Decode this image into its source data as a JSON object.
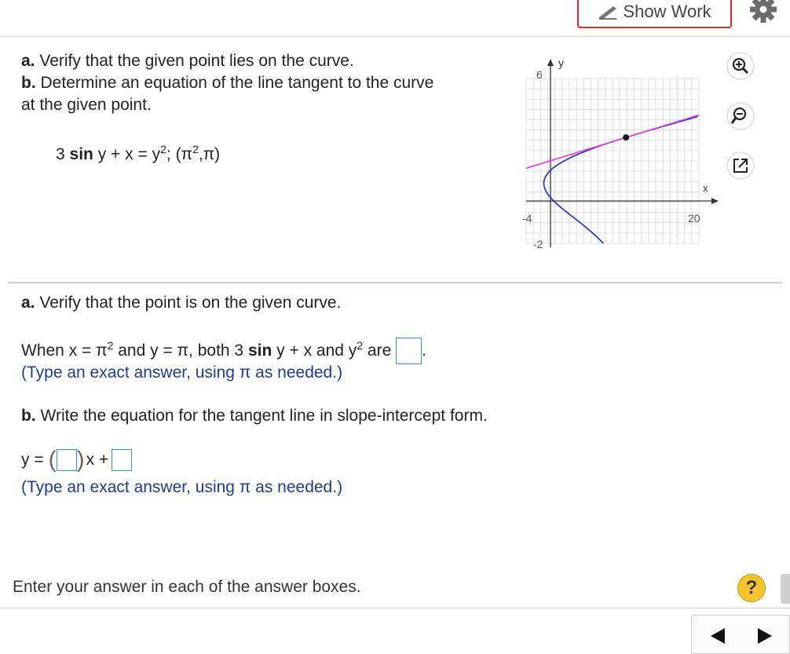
{
  "header": {
    "show_work_label": "Show Work"
  },
  "problem": {
    "part_a_label": "a.",
    "part_a_text": "Verify that the given point lies on the curve.",
    "part_b_label": "b.",
    "part_b_text": "Determine an equation of the line tangent to the curve",
    "part_b_text2": "at the given point.",
    "equation": {
      "coef": "3",
      "sin": "sin",
      "lhs_rest": "y + x = y",
      "exp": "2",
      "sep": ";",
      "point_open": "(π",
      "point_exp": "2",
      "point_close": ",π)"
    }
  },
  "graph": {
    "y_label": "y",
    "x_label": "x",
    "y_tick_top": "6",
    "y_tick_bottom": "-2",
    "x_tick_left": "-4",
    "x_tick_right": "20"
  },
  "chart_data": {
    "type": "line",
    "xlim": [
      -4,
      20
    ],
    "ylim": [
      -2,
      6
    ],
    "series": [
      {
        "kind": "curve",
        "equation": "x = y^2 - 3 sin y",
        "color": "#1a2cc8"
      },
      {
        "kind": "tangent_line",
        "color": "#e040e0"
      }
    ],
    "points": [
      {
        "x": 9.87,
        "y": 3.14
      }
    ]
  },
  "part_a": {
    "heading_label": "a.",
    "heading_text": "Verify that the point is on the given curve.",
    "when": "When x = π",
    "exp1": "2",
    "and1": " and y = π, both 3 ",
    "sin": "sin",
    "mid": " y + x and y",
    "exp2": "2",
    "are": " are",
    "period": ".",
    "hint": "(Type an exact answer, using π as needed.)"
  },
  "part_b": {
    "heading_label": "b.",
    "heading_text": "Write the equation for the tangent line in slope-intercept form.",
    "y_eq": "y =",
    "x_plus": "x +",
    "hint": "(Type an exact answer, using π as needed.)"
  },
  "footer": {
    "instruction": "Enter your answer in each of the answer boxes.",
    "help": "?"
  },
  "icons": [
    "pencil-icon",
    "gear-icon",
    "zoom-in-icon",
    "zoom-out-icon",
    "popout-icon",
    "help-icon",
    "prev-arrow-icon",
    "next-arrow-icon"
  ]
}
